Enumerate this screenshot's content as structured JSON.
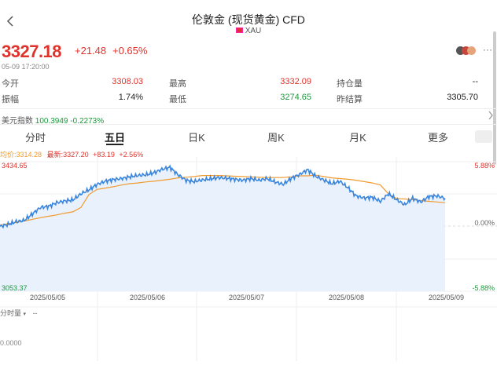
{
  "header": {
    "back_icon": "chevron-left-icon",
    "title": "伦敦金 (现货黄金) CFD",
    "symbol": "XAU"
  },
  "quote": {
    "price": "3327.18",
    "change": "+21.48",
    "change_pct": "+0.65%",
    "time": "05-09 17:20:00",
    "more_icon": "···"
  },
  "stats": [
    {
      "label": "今开",
      "value": "3308.03",
      "color": "red"
    },
    {
      "label": "最高",
      "value": "3332.09",
      "color": "red"
    },
    {
      "label": "持仓量",
      "value": "--",
      "color": "blk"
    },
    {
      "label": "振幅",
      "value": "1.74%",
      "color": "blk"
    },
    {
      "label": "最低",
      "value": "3274.65",
      "color": "green"
    },
    {
      "label": "昨结算",
      "value": "3305.70",
      "color": "blk"
    }
  ],
  "index": {
    "label": "美元指数",
    "value": "100.3949",
    "change": "-0.2273%"
  },
  "tabs": [
    {
      "label": "分时",
      "active": false
    },
    {
      "label": "五日",
      "active": true
    },
    {
      "label": "日K",
      "active": false
    },
    {
      "label": "周K",
      "active": false
    },
    {
      "label": "月K",
      "active": false
    },
    {
      "label": "更多",
      "active": false
    }
  ],
  "legend": {
    "avg": "均价:3314.28",
    "latest": "最新:3327.20",
    "chg": "+83.19",
    "pct": "+2.56%"
  },
  "axis": {
    "y_top": "3434.65",
    "y_bottom": "3053.37",
    "pct_top": "5.88%",
    "pct_mid": "0.00%",
    "pct_bottom": "-5.88%",
    "dates": [
      "2025/05/05",
      "2025/05/06",
      "2025/05/07",
      "2025/05/08",
      "2025/05/09"
    ]
  },
  "volume": {
    "label": "分时量",
    "value": "--",
    "zero": "0.0000"
  },
  "colors": {
    "up": "#e0322b",
    "down": "#1b9a3c",
    "price_line": "#3a86de",
    "avg_line": "#f29a2e"
  },
  "chart_data": {
    "type": "line",
    "title": "",
    "x": [
      "2025/05/05",
      "2025/05/06",
      "2025/05/07",
      "2025/05/08",
      "2025/05/09"
    ],
    "ylim": [
      3053.37,
      3434.65
    ],
    "series": [
      {
        "name": "最新",
        "values": [
          3244,
          3250,
          3258,
          3262,
          3281,
          3300,
          3303,
          3314,
          3319,
          3322,
          3340,
          3352,
          3368,
          3377,
          3382,
          3385,
          3390,
          3394,
          3396,
          3402,
          3412,
          3418,
          3396,
          3380,
          3376,
          3381,
          3384,
          3388,
          3386,
          3383,
          3380,
          3385,
          3380,
          3385,
          3375,
          3368,
          3386,
          3397,
          3411,
          3392,
          3381,
          3370,
          3377,
          3358,
          3334,
          3328,
          3330,
          3318,
          3340,
          3323,
          3308,
          3327,
          3316,
          3332,
          3334,
          3327
        ]
      },
      {
        "name": "均价",
        "values": [
          3248,
          3252,
          3256,
          3260,
          3265,
          3270,
          3274,
          3278,
          3283,
          3287,
          3300,
          3338,
          3353,
          3357,
          3361,
          3366,
          3370,
          3372,
          3375,
          3377,
          3380,
          3383,
          3387,
          3389,
          3391,
          3394,
          3394,
          3394,
          3393,
          3392,
          3391,
          3390,
          3389,
          3388,
          3388,
          3388,
          3390,
          3393,
          3393,
          3395,
          3391,
          3387,
          3385,
          3383,
          3380,
          3376,
          3372,
          3366,
          3340,
          3326,
          3325,
          3323,
          3320,
          3318,
          3316,
          3314
        ]
      }
    ],
    "ylabel": ""
  }
}
